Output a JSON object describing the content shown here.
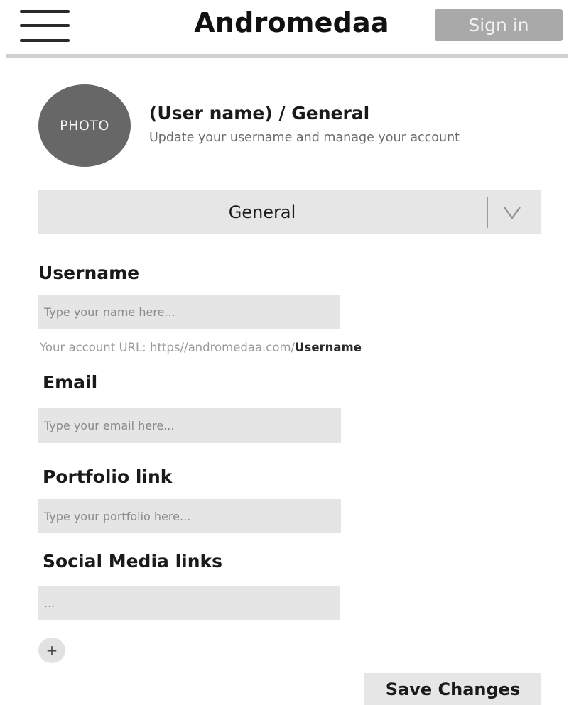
{
  "header": {
    "app_title": "Andromedaa",
    "sign_in_label": "Sign in",
    "menu_icon": "hamburger-menu-icon"
  },
  "profile": {
    "avatar_text": "PHOTO",
    "title": "(User name) / General",
    "subtitle": "Update your username and manage your account"
  },
  "section_select": {
    "selected": "General",
    "icon": "chevron-down-icon"
  },
  "form": {
    "username": {
      "label": "Username",
      "placeholder": "Type your name here...",
      "url_hint_prefix": "Your account URL: https//andromedaa.com/",
      "url_hint_suffix": "Username"
    },
    "email": {
      "label": "Email",
      "placeholder": "Type your email here..."
    },
    "portfolio": {
      "label": "Portfolio link",
      "placeholder": "Type your portfolio here..."
    },
    "social": {
      "label": "Social Media links",
      "placeholder": "..."
    },
    "add_button_label": "+",
    "save_label": "Save Changes"
  },
  "colors": {
    "sign_in_bg": "#a9a9a9",
    "avatar_bg": "#676767",
    "input_bg": "#e5e5e5",
    "header_rule": "#cfcfcf"
  }
}
